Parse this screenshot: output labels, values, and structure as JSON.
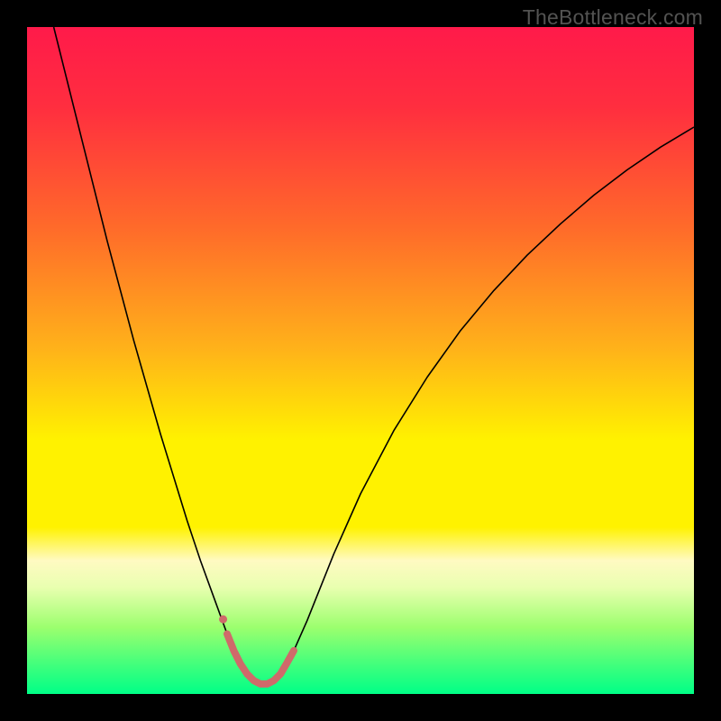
{
  "watermark": "TheBottleneck.com",
  "chart_data": {
    "type": "line",
    "title": "",
    "xlabel": "",
    "ylabel": "",
    "xlim": [
      0,
      100
    ],
    "ylim": [
      0,
      100
    ],
    "grid": false,
    "legend": false,
    "background_gradient_stops": [
      {
        "offset": 0.0,
        "color": "#ff1a4a"
      },
      {
        "offset": 0.12,
        "color": "#ff2e3f"
      },
      {
        "offset": 0.3,
        "color": "#ff6a2a"
      },
      {
        "offset": 0.48,
        "color": "#ffb11a"
      },
      {
        "offset": 0.62,
        "color": "#fff200"
      },
      {
        "offset": 0.75,
        "color": "#fff200"
      },
      {
        "offset": 0.8,
        "color": "#fffac2"
      },
      {
        "offset": 0.84,
        "color": "#e9ffb0"
      },
      {
        "offset": 0.9,
        "color": "#9cff6e"
      },
      {
        "offset": 0.96,
        "color": "#3bff7d"
      },
      {
        "offset": 1.0,
        "color": "#00ff87"
      }
    ],
    "series": [
      {
        "name": "bottleneck-curve",
        "stroke": "#000000",
        "stroke_width": 1.6,
        "x": [
          4.0,
          6.0,
          8.0,
          10.0,
          12.0,
          14.0,
          16.0,
          18.0,
          20.0,
          22.0,
          24.0,
          26.0,
          28.0,
          30.0,
          31.0,
          32.0,
          33.0,
          34.0,
          35.0,
          36.0,
          37.0,
          38.0,
          40.0,
          42.0,
          44.0,
          46.0,
          50.0,
          55.0,
          60.0,
          65.0,
          70.0,
          75.0,
          80.0,
          85.0,
          90.0,
          95.0,
          100.0
        ],
        "y": [
          100.0,
          92.0,
          84.0,
          76.0,
          68.0,
          60.5,
          53.0,
          46.0,
          39.0,
          32.5,
          26.0,
          20.0,
          14.5,
          9.0,
          6.5,
          4.5,
          3.0,
          2.0,
          1.5,
          1.5,
          2.0,
          3.0,
          6.5,
          11.0,
          16.0,
          21.0,
          30.0,
          39.5,
          47.5,
          54.5,
          60.5,
          65.8,
          70.5,
          74.8,
          78.6,
          82.0,
          85.0
        ]
      },
      {
        "name": "highlight-segment",
        "stroke": "#cf6a6a",
        "stroke_width": 8,
        "linecap": "round",
        "x": [
          30.0,
          31.0,
          32.0,
          33.0,
          34.0,
          35.0,
          36.0,
          37.0,
          38.0,
          39.0,
          40.0
        ],
        "y": [
          9.0,
          6.5,
          4.5,
          3.0,
          2.0,
          1.5,
          1.5,
          2.0,
          3.0,
          4.7,
          6.5
        ]
      }
    ],
    "markers": [
      {
        "name": "highlight-dot",
        "x": 29.4,
        "y": 11.2,
        "r": 4.5,
        "fill": "#cf6a6a"
      }
    ]
  }
}
